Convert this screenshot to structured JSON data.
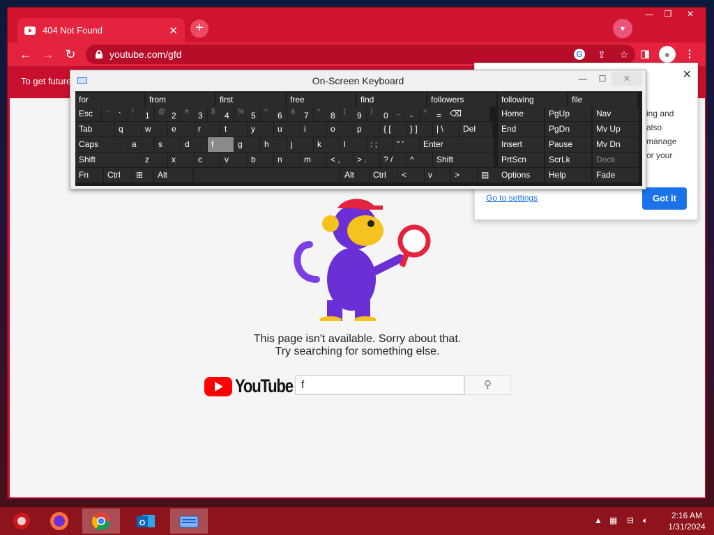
{
  "browser": {
    "tab_title": "404 Not Found",
    "tab_close": "✕",
    "new_tab": "+",
    "url": "youtube.com/gfd",
    "window_controls": {
      "minimize": "—",
      "maximize": "❐",
      "close": "✕"
    },
    "infobar_text": "To get future"
  },
  "page": {
    "message_line1": "This page isn't available. Sorry about that.",
    "message_line2": "Try searching for something else.",
    "logo_text": "YouTube",
    "search_value": "f"
  },
  "popup": {
    "close": "✕",
    "text_lines": [
      "ing and",
      "also",
      "manage",
      "or your"
    ],
    "link": "Go to settings",
    "button": "Got it"
  },
  "osk": {
    "title": "On-Screen Keyboard",
    "predictions": [
      "for",
      "from",
      "first",
      "free",
      "find",
      "followers",
      "following",
      "file"
    ],
    "row1": [
      {
        "label": "Esc"
      },
      {
        "shift": "~",
        "main": "`"
      },
      {
        "shift": "!",
        "main": "1"
      },
      {
        "shift": "@",
        "main": "2"
      },
      {
        "shift": "#",
        "main": "3"
      },
      {
        "shift": "$",
        "main": "4"
      },
      {
        "shift": "%",
        "main": "5"
      },
      {
        "shift": "^",
        "main": "6"
      },
      {
        "shift": "&",
        "main": "7"
      },
      {
        "shift": "*",
        "main": "8"
      },
      {
        "shift": "(",
        "main": "9"
      },
      {
        "shift": ")",
        "main": "0"
      },
      {
        "shift": "_",
        "main": "-"
      },
      {
        "shift": "+",
        "main": "="
      },
      {
        "label": "⌫"
      }
    ],
    "row2": [
      "Tab",
      "q",
      "w",
      "e",
      "r",
      "t",
      "y",
      "u",
      "i",
      "o",
      "p",
      "{ [",
      "} ]",
      "| \\",
      "Del"
    ],
    "row3": [
      "Caps",
      "a",
      "s",
      "d",
      "f",
      "g",
      "h",
      "j",
      "k",
      "l",
      ": ;",
      "\" '",
      "Enter"
    ],
    "row4": [
      "Shift",
      "z",
      "x",
      "c",
      "v",
      "b",
      "n",
      "m",
      "< ,",
      "> .",
      "? /",
      "^",
      "Shift"
    ],
    "row5": [
      "Fn",
      "Ctrl",
      "⊞",
      "Alt",
      "",
      "Alt",
      "Ctrl",
      "<",
      "v",
      ">",
      "▤"
    ],
    "nav": [
      [
        "Home",
        "PgUp",
        "Nav"
      ],
      [
        "End",
        "PgDn",
        "Mv Up"
      ],
      [
        "Insert",
        "Pause",
        "Mv Dn"
      ],
      [
        "PrtScn",
        "ScrLk",
        "Dock"
      ],
      [
        "Options",
        "Help",
        "Fade"
      ]
    ]
  },
  "taskbar": {
    "time": "2:16 AM",
    "date": "1/31/2024"
  },
  "colors": {
    "browser_red": "#c8102e",
    "youtube_red": "#ff0000",
    "link_blue": "#1a73e8"
  }
}
